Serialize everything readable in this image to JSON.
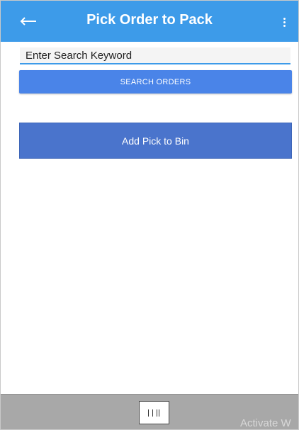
{
  "app_bar": {
    "title": "Pick Order to Pack",
    "back_icon": "arrow-left-icon",
    "menu_icon": "more-vert-icon",
    "color": "#3d9be9"
  },
  "search": {
    "placeholder": "Enter Search Keyword",
    "value": ""
  },
  "buttons": {
    "search_orders": "SEARCH ORDERS",
    "add_pick_to_bin": "Add Pick to Bin"
  },
  "bottom_bar": {
    "barcode_icon": "barcode-scan-icon"
  },
  "watermark": {
    "text": "Activate W"
  },
  "colors": {
    "accent": "#3d9be9",
    "search_button": "#4a84e8",
    "add_button": "#4a74cc",
    "bottom_bar": "#a8a8a8"
  }
}
